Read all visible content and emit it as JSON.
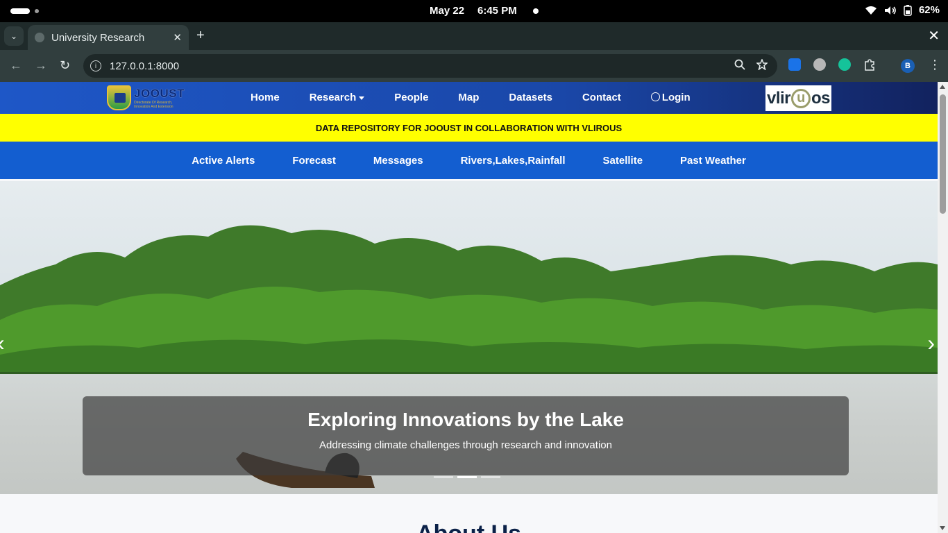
{
  "os": {
    "date": "May 22",
    "time": "6:45 PM",
    "battery": "62%"
  },
  "browser": {
    "tab_title": "University Research",
    "url": "127.0.0.1:8000",
    "new_tab": "+",
    "close_tab": "✕",
    "close_window": "✕",
    "profile_initial": "B"
  },
  "site": {
    "logo_left_title": "JOOUST",
    "logo_left_subtitle": "Directorate Of Research, Innovation And Extension",
    "nav": [
      {
        "label": "Home"
      },
      {
        "label": "Research"
      },
      {
        "label": "People"
      },
      {
        "label": "Map"
      },
      {
        "label": "Datasets"
      },
      {
        "label": "Contact"
      },
      {
        "label": "Login"
      }
    ],
    "logo_right_text_a": "vl",
    "logo_right_text_b": "i",
    "logo_right_text_c": "r",
    "logo_right_text_u": "u",
    "logo_right_text_d": "os",
    "banner": "DATA REPOSITORY FOR JOOUST IN COLLABORATION WITH VLIROUS",
    "subnav": [
      {
        "label": "Active Alerts"
      },
      {
        "label": "Forecast"
      },
      {
        "label": "Messages"
      },
      {
        "label": "Rivers,Lakes,Rainfall"
      },
      {
        "label": "Satellite"
      },
      {
        "label": "Past Weather"
      }
    ],
    "hero": {
      "title": "Exploring Innovations by the Lake",
      "subtitle": "Addressing climate challenges through research and innovation",
      "active_slide": 2,
      "slide_count": 3
    },
    "about_title": "About Us"
  }
}
